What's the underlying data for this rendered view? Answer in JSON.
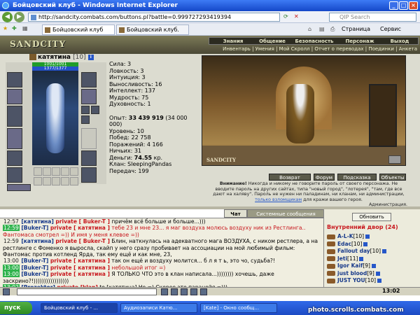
{
  "window": {
    "title": "Бойцовский клуб - Windows Internet Explorer"
  },
  "address": {
    "url": "http://sandcity.combats.com/buttons.pl?battle=0.999727293419394",
    "search_placeholder": "QIP Search"
  },
  "tabs": [
    {
      "label": "Бойцовский клуб"
    },
    {
      "label": "Бойцовский клуб."
    }
  ],
  "browser_toolbar": {
    "page": "Страница",
    "tools": "Сервис"
  },
  "game": {
    "logo": "SANDCITY",
    "menu": [
      "Знания",
      "Общение",
      "Безопасность",
      "Персонаж",
      "Выход"
    ],
    "submenu": "Инвентарь | Умения | Мой Скролл | Отчет о переводах | Поединки | Анкета"
  },
  "character": {
    "name": "катятина",
    "level": "[10]",
    "hp": "1001/1001",
    "mana": "1377/1377",
    "stats": [
      "Сила: 3",
      "Ловкость: 3",
      "Интуиция: 3",
      "Выносливость: 16",
      "Интеллект: 137",
      "Мудрость: 75",
      "Духовность: 1"
    ],
    "exp_label": "Опыт: ",
    "exp_value": "33 439 919",
    "exp_next": " (34 000 000)",
    "level_line": "Уровень: 10",
    "wins": "Побед: 22 758",
    "losses": "Поражений: 4 166",
    "draws": "Ничьих: 31",
    "money_label": "Деньги: ",
    "money_value": "74.55",
    "money_unit": " кр.",
    "clan": "Клан: SleepingPandas",
    "transfers": "Передач: 199"
  },
  "scene": {
    "signature": "SANDCITY"
  },
  "actions": {
    "return": "Возврат",
    "forum": "Форум",
    "hint": "Подсказка",
    "objects": "Объекты"
  },
  "warning": {
    "bold": "Внимание!",
    "text": " Никогда и никому не говорите пароль от своего персонажа. Не вводите пароль на других сайтах, типа \"новый город\", \"лотерея\", \"там, где все дают на халяву\". Пароль не нужен ни паладинам, ни кланам, ни администрации, ",
    "link": "только взломщикам",
    "tail": " для кражи вашего героя.",
    "sign": "Администрация."
  },
  "chat_tabs": {
    "chat": "Чат",
    "system": "Системные сообщения"
  },
  "chat": [
    {
      "time": "12:57",
      "nick": "[катятина]",
      "priv": "private [ Buker-T ]",
      "text": " причём всё больше и больше...)))",
      "green": false,
      "red": false
    },
    {
      "time": "12:59",
      "nick": "[Buker-T]",
      "priv": "private [ катятина ]",
      "text": " тебе 23 и мне 23... я маг воздуха молюсь воздуху ник из Рестлинга.. Фантомаса смотрел =)) И имя у меня клевое =))",
      "green": true,
      "red": true
    },
    {
      "time": "12:59",
      "nick": "[катятина]",
      "priv": "private [ Buker-T ]",
      "text": " Блин, наткнулась на адекватного мага ВОЗДУХА, с ником рестлера, а на рестлинге с Фоменко я выросла, скайп у него сразу пробивает на ассоциации на мой любимый фильм: Фантомас против котленд Ярда, так ему ещё и как мне, 23,",
      "green": false,
      "red": false
    },
    {
      "time": "13:00",
      "nick": "[Buker-T]",
      "priv": "private [ катятина ]",
      "text": " так он ещё и воздуху молится... б л я т ь, это чо, судьба?!",
      "green": false,
      "red": false
    },
    {
      "time": "13:00",
      "nick": "[Buker-T]",
      "priv": "private [ катятина ]",
      "text": " небольшой итог =)",
      "green": true,
      "red": true
    },
    {
      "time": "13:00",
      "nick": "[Buker-T]",
      "priv": "private [ катятина ]",
      "text": " Я ТОЛЬКО ЧТО это в клан написала...)))))))) хочешь, даже заскрино?!)))))))))))))))))",
      "green": true,
      "red": false
    },
    {
      "time": "13:02",
      "nick": "[Prozektor]",
      "priv": "private [klan]",
      "text": " to [катятина] Не =) Скорее это паранойя =)))",
      "green": true,
      "red": false
    }
  ],
  "roster": {
    "refresh": "Обновить",
    "room": "Внутренний двор (24)",
    "users": [
      {
        "name": "A-L-K",
        "level": "[10]"
      },
      {
        "name": "Edac",
        "level": "[10]"
      },
      {
        "name": "Fallout day",
        "level": "[10]"
      },
      {
        "name": "Jeti",
        "level": "[11]"
      },
      {
        "name": "Igor Kaif",
        "level": "[9]"
      },
      {
        "name": "just blood",
        "level": "[9]"
      },
      {
        "name": "JUST YOU",
        "level": "[10]"
      }
    ]
  },
  "game_clock": "13:02",
  "taskbar": {
    "start": "пуск",
    "items": [
      "Бойцовский клуб - ...",
      "Аудиозаписи Катю...",
      "[Kate] - Окно сообщ..."
    ]
  },
  "watermark": "photo.scrolls.combats.com"
}
